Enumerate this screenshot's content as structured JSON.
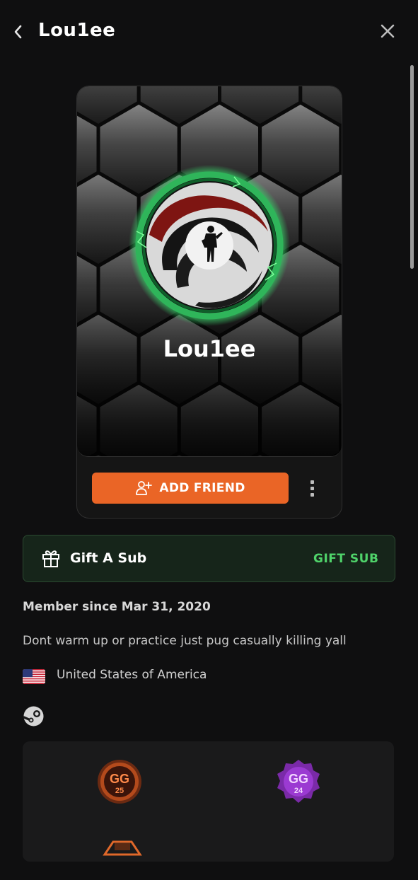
{
  "header": {
    "title": "Lou1ee",
    "back_icon": "chevron-left-icon",
    "close_icon": "close-icon"
  },
  "profile_card": {
    "username": "Lou1ee",
    "add_friend_label": "ADD FRIEND",
    "add_friend_icon": "user-plus-icon",
    "more_icon": "more-vertical-icon",
    "accent_color": "#ea6526"
  },
  "gift": {
    "title": "Gift A Sub",
    "button_label": "GIFT SUB",
    "icon": "gift-icon",
    "accent_color": "#4fd36a"
  },
  "about": {
    "member_since": "Member since Mar 31, 2020",
    "bio": "Dont warm up or practice just pug casually killing yall",
    "country": "United States of America",
    "flag_icon": "us-flag-icon",
    "linked_account_icon": "steam-icon"
  },
  "badges": {
    "items": [
      {
        "text": "GG",
        "sub": "25",
        "icon": "gg25-badge-icon"
      },
      {
        "text": "GG",
        "sub": "24",
        "icon": "gg24-badge-icon"
      },
      {
        "icon": "rank-badge-icon"
      }
    ]
  }
}
